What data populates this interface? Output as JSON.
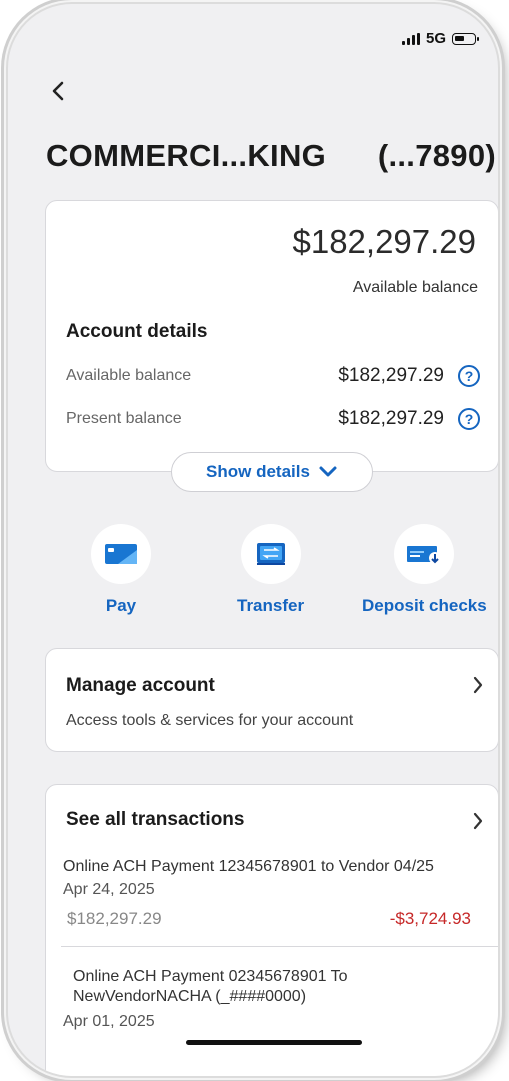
{
  "status_bar": {
    "network": "5G"
  },
  "header": {
    "back_icon": "chevron-left-icon",
    "account_name": "COMMERCI...KING",
    "account_number": "(...7890)"
  },
  "balance_card": {
    "balance": "$182,297.29",
    "balance_label": "Available balance",
    "details_title": "Account details",
    "rows": [
      {
        "label": "Available balance",
        "value": "$182,297.29"
      },
      {
        "label": "Present balance",
        "value": "$182,297.29"
      }
    ],
    "show_details_label": "Show details"
  },
  "actions": [
    {
      "label": "Pay",
      "icon": "card-icon"
    },
    {
      "label": "Transfer",
      "icon": "transfer-icon"
    },
    {
      "label": "Deposit checks",
      "icon": "check-deposit-icon"
    }
  ],
  "manage_account": {
    "title": "Manage account",
    "subtitle": "Access tools & services for your account"
  },
  "transactions": {
    "title": "See all transactions",
    "items": [
      {
        "description": "Online ACH Payment 12345678901 to Vendor 04/25",
        "date": "Apr 24, 2025",
        "balance": "$182,297.29",
        "amount": "-$3,724.93"
      },
      {
        "description": "Online ACH Payment 02345678901 To NewVendorNACHA (_####0000)",
        "date": "Apr 01, 2025"
      }
    ]
  },
  "colors": {
    "accent": "#1565c0",
    "negative": "#c62828",
    "background": "#f0f0f2"
  }
}
